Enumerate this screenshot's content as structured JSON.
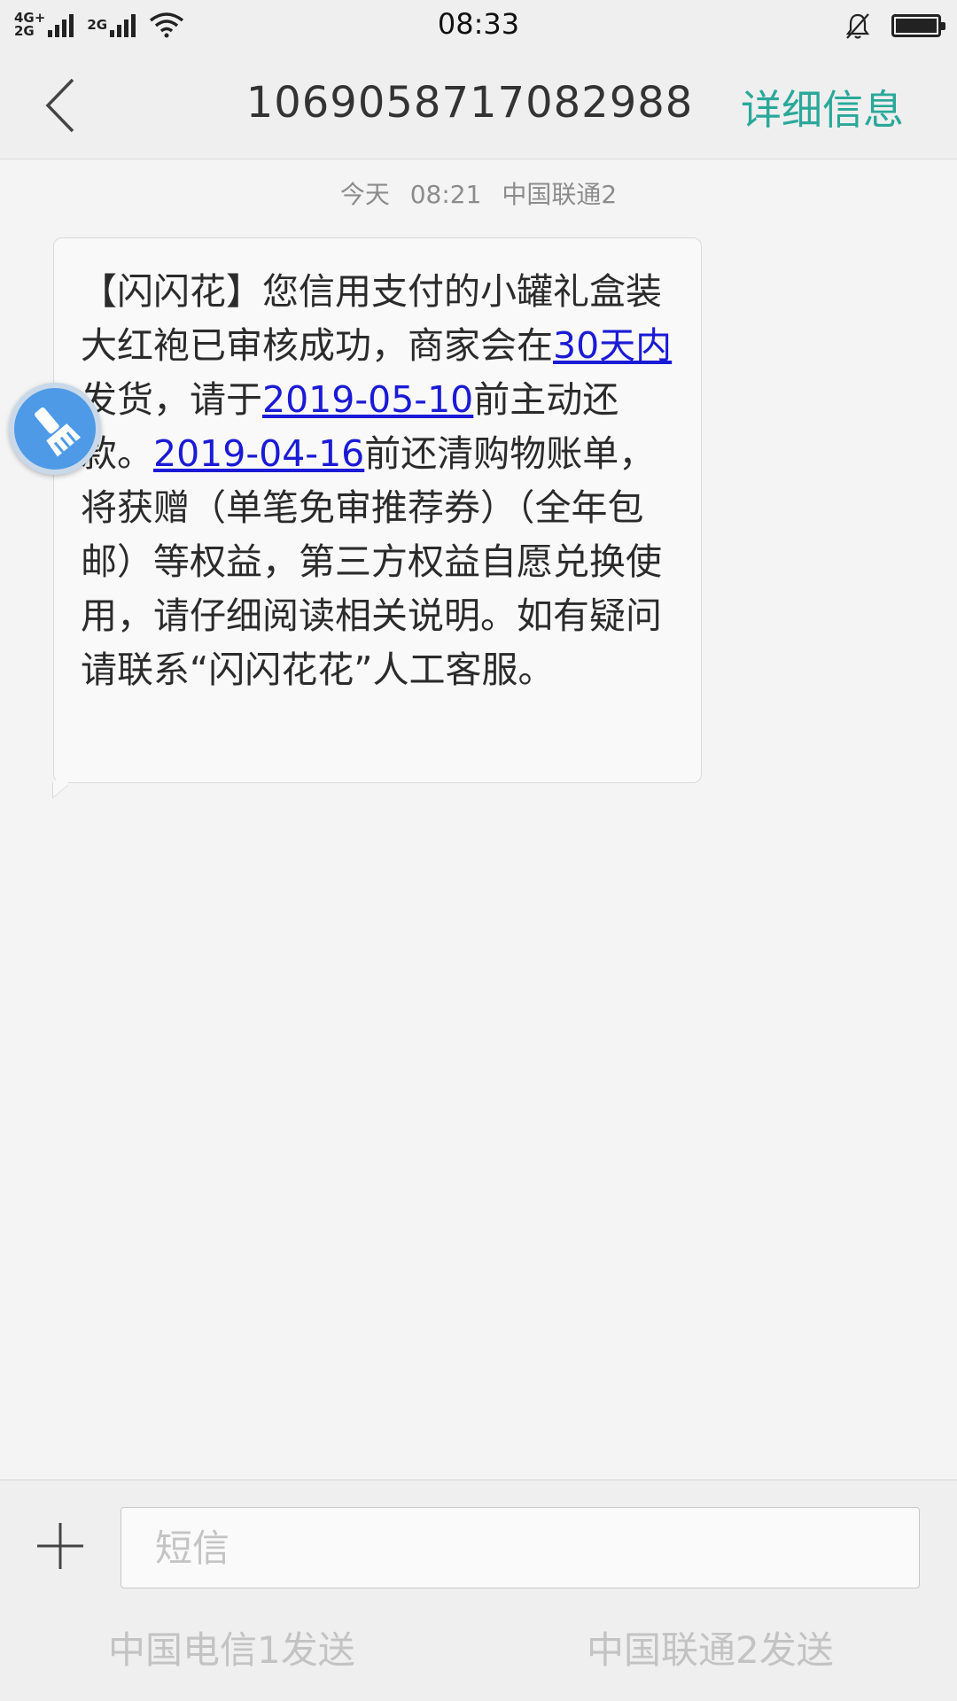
{
  "status_bar": {
    "network_1": [
      "4G+",
      "2G"
    ],
    "network_2": "2G",
    "time": "08:33"
  },
  "header": {
    "contact_number": "1069058717082988",
    "details_label": "详细信息"
  },
  "conversation": {
    "timestamp": {
      "day": "今天",
      "time": "08:21",
      "carrier": "中国联通2"
    },
    "message": {
      "seg1": "【闪闪花】您信用支付的小罐礼盒装大红袍已审核成功，商家会在",
      "link1": "30天内",
      "seg2": "发货，请于",
      "link2": "2019-05-10",
      "seg3": "前主动还款。",
      "link3": "2019-04-16",
      "seg4": "前还清购物账单，将获赠（单笔免审推荐券）（全年包邮）等权益，第三方权益自愿兑换使用，请仔细阅读相关说明。如有疑问请联系“闪闪花花”人工客服。"
    }
  },
  "compose": {
    "placeholder": "短信",
    "send_sim1": "中国电信1发送",
    "send_sim2": "中国联通2发送"
  },
  "icons": {
    "back": "chevron-left-icon",
    "attach": "plus-icon",
    "floating": "brush-icon",
    "mute": "bell-off-icon",
    "wifi": "wifi-icon",
    "battery": "battery-icon"
  },
  "colors": {
    "accent": "#2aa89a",
    "link": "#1a1ad6",
    "background": "#f4f4f4"
  }
}
